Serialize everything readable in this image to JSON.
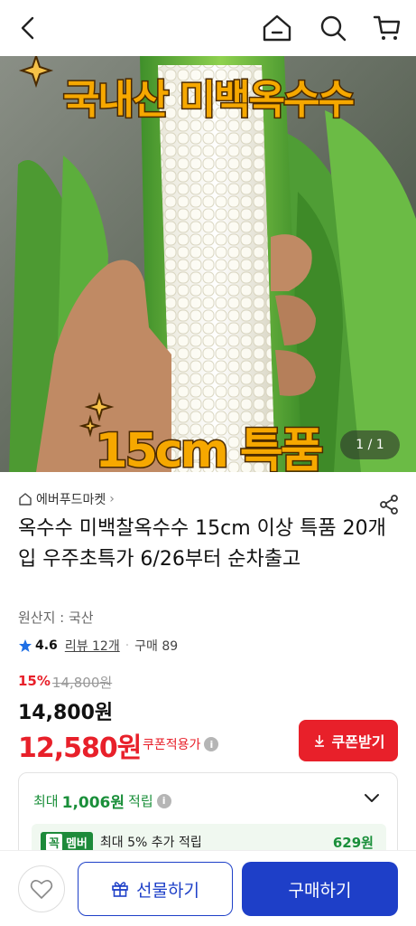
{
  "header": {
    "back_icon": "chevron-left-icon",
    "home_icon": "home-icon",
    "search_icon": "search-icon",
    "cart_icon": "cart-icon"
  },
  "hero": {
    "title": "국내산 미백옥수수",
    "subtitle": "15cm 특품",
    "counter": "1 / 1"
  },
  "seller": {
    "name": "에버푸드마켓",
    "arrow": "›"
  },
  "product": {
    "title": "옥수수 미백찰옥수수 15cm 이상 특품 20개입 우주초특가 6/26부터 순차출고",
    "origin": "원산지 : 국산"
  },
  "rating": {
    "score": "4.6",
    "reviews": "리뷰 12개",
    "sales": "구매 89"
  },
  "pricing": {
    "discount_pct": "15%",
    "original_price": "14,800원",
    "price": "14,800원",
    "coupon_price": "12,580원",
    "coupon_label": "쿠폰적용가",
    "coupon_button": "쿠폰받기"
  },
  "points": {
    "prefix": "최대",
    "amount": "1,006원",
    "suffix": "적립",
    "member_badge_k": "꼭",
    "member_badge": "멤버",
    "member_text": "최대 5% 추가 적립",
    "member_amount": "629원"
  },
  "bottom": {
    "gift_label": "선물하기",
    "buy_label": "구매하기"
  },
  "colors": {
    "accent_red": "#e8202a",
    "accent_blue": "#1e3fc8",
    "accent_green": "#1a8f3a"
  }
}
